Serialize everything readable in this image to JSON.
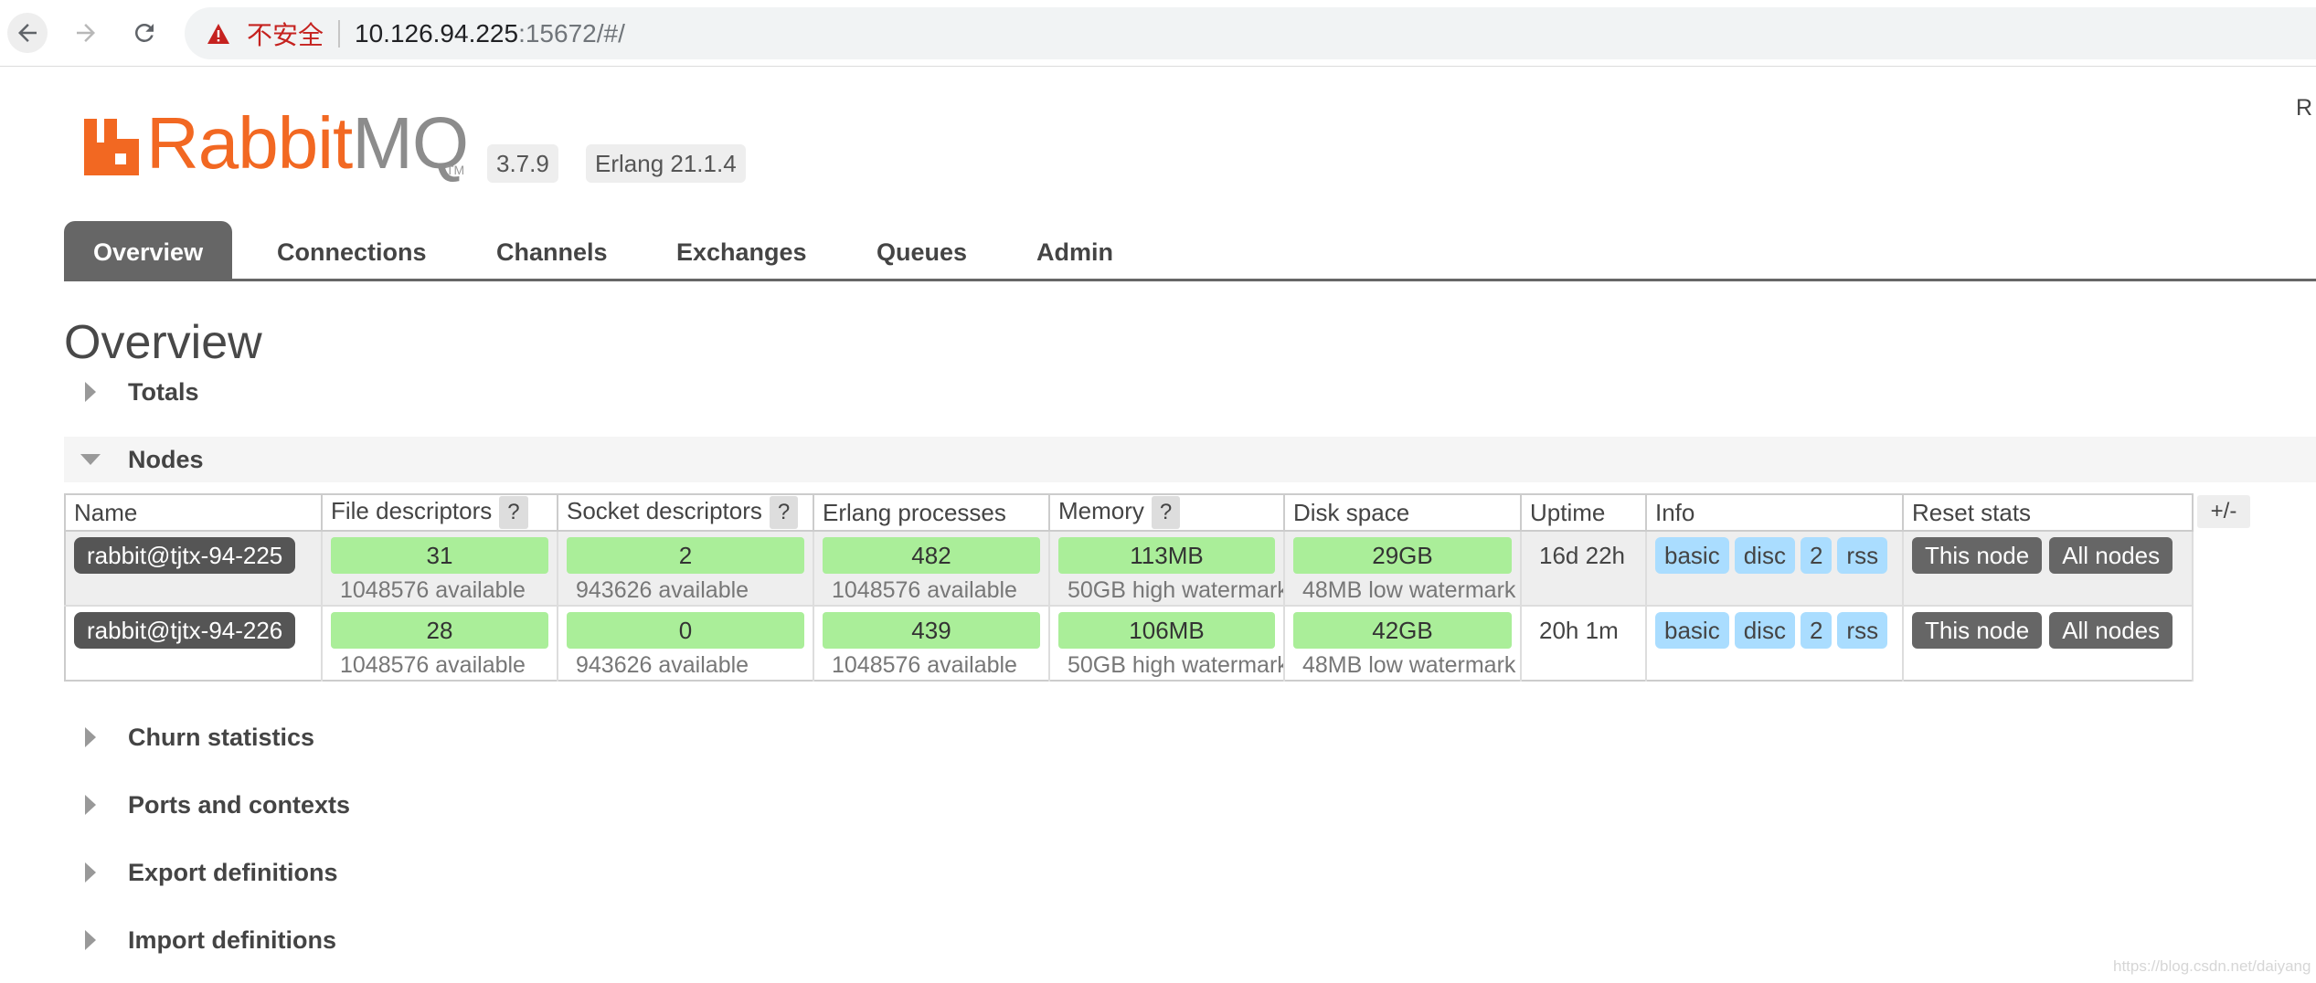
{
  "browser": {
    "security_label": "不安全",
    "url_host": "10.126.94.225",
    "url_rest": ":15672/#/",
    "icons": [
      "back-arrow-icon",
      "forward-arrow-icon",
      "reload-icon",
      "warning-icon"
    ]
  },
  "header": {
    "logo_text_rabbit": "Rabbit",
    "logo_text_mq": "MQ",
    "logo_tm": "TM",
    "rabbitmq_version": "3.7.9",
    "erlang_version": "Erlang 21.1.4",
    "user_edge": "R",
    "brand_color": "#f26822"
  },
  "tabs": [
    {
      "label": "Overview",
      "active": true
    },
    {
      "label": "Connections"
    },
    {
      "label": "Channels"
    },
    {
      "label": "Exchanges"
    },
    {
      "label": "Queues"
    },
    {
      "label": "Admin"
    }
  ],
  "page_title": "Overview",
  "sections": {
    "totals": "Totals",
    "nodes": "Nodes",
    "churn": "Churn statistics",
    "ports": "Ports and contexts",
    "export": "Export definitions",
    "import": "Import definitions"
  },
  "nodes_table": {
    "headers": {
      "name": "Name",
      "file_descriptors": "File descriptors",
      "socket_descriptors": "Socket descriptors",
      "erlang_processes": "Erlang processes",
      "memory": "Memory",
      "disk_space": "Disk space",
      "uptime": "Uptime",
      "info": "Info",
      "reset_stats": "Reset stats",
      "help": "?"
    },
    "rows": [
      {
        "name": "rabbit@tjtx-94-225",
        "file_descriptors": "31",
        "file_descriptors_available": "1048576 available",
        "socket_descriptors": "2",
        "socket_descriptors_available": "943626 available",
        "erlang_processes": "482",
        "erlang_processes_available": "1048576 available",
        "memory": "113MB",
        "memory_watermark": "50GB high watermark",
        "disk_space": "29GB",
        "disk_watermark": "48MB low watermark",
        "uptime": "16d 22h",
        "info": [
          "basic",
          "disc",
          "2",
          "rss"
        ],
        "reset_this": "This node",
        "reset_all": "All nodes"
      },
      {
        "name": "rabbit@tjtx-94-226",
        "file_descriptors": "28",
        "file_descriptors_available": "1048576 available",
        "socket_descriptors": "0",
        "socket_descriptors_available": "943626 available",
        "erlang_processes": "439",
        "erlang_processes_available": "1048576 available",
        "memory": "106MB",
        "memory_watermark": "50GB high watermark",
        "disk_space": "42GB",
        "disk_watermark": "48MB low watermark",
        "uptime": "20h 1m",
        "info": [
          "basic",
          "disc",
          "2",
          "rss"
        ],
        "reset_this": "This node",
        "reset_all": "All nodes"
      }
    ],
    "column_toggle": "+/-"
  },
  "watermark": "https://blog.csdn.net/daiyang",
  "colors": {
    "meter_green": "#aaee99",
    "info_blue": "#aaddff",
    "dark_button": "#666666",
    "insecure_red": "#c5221f"
  }
}
